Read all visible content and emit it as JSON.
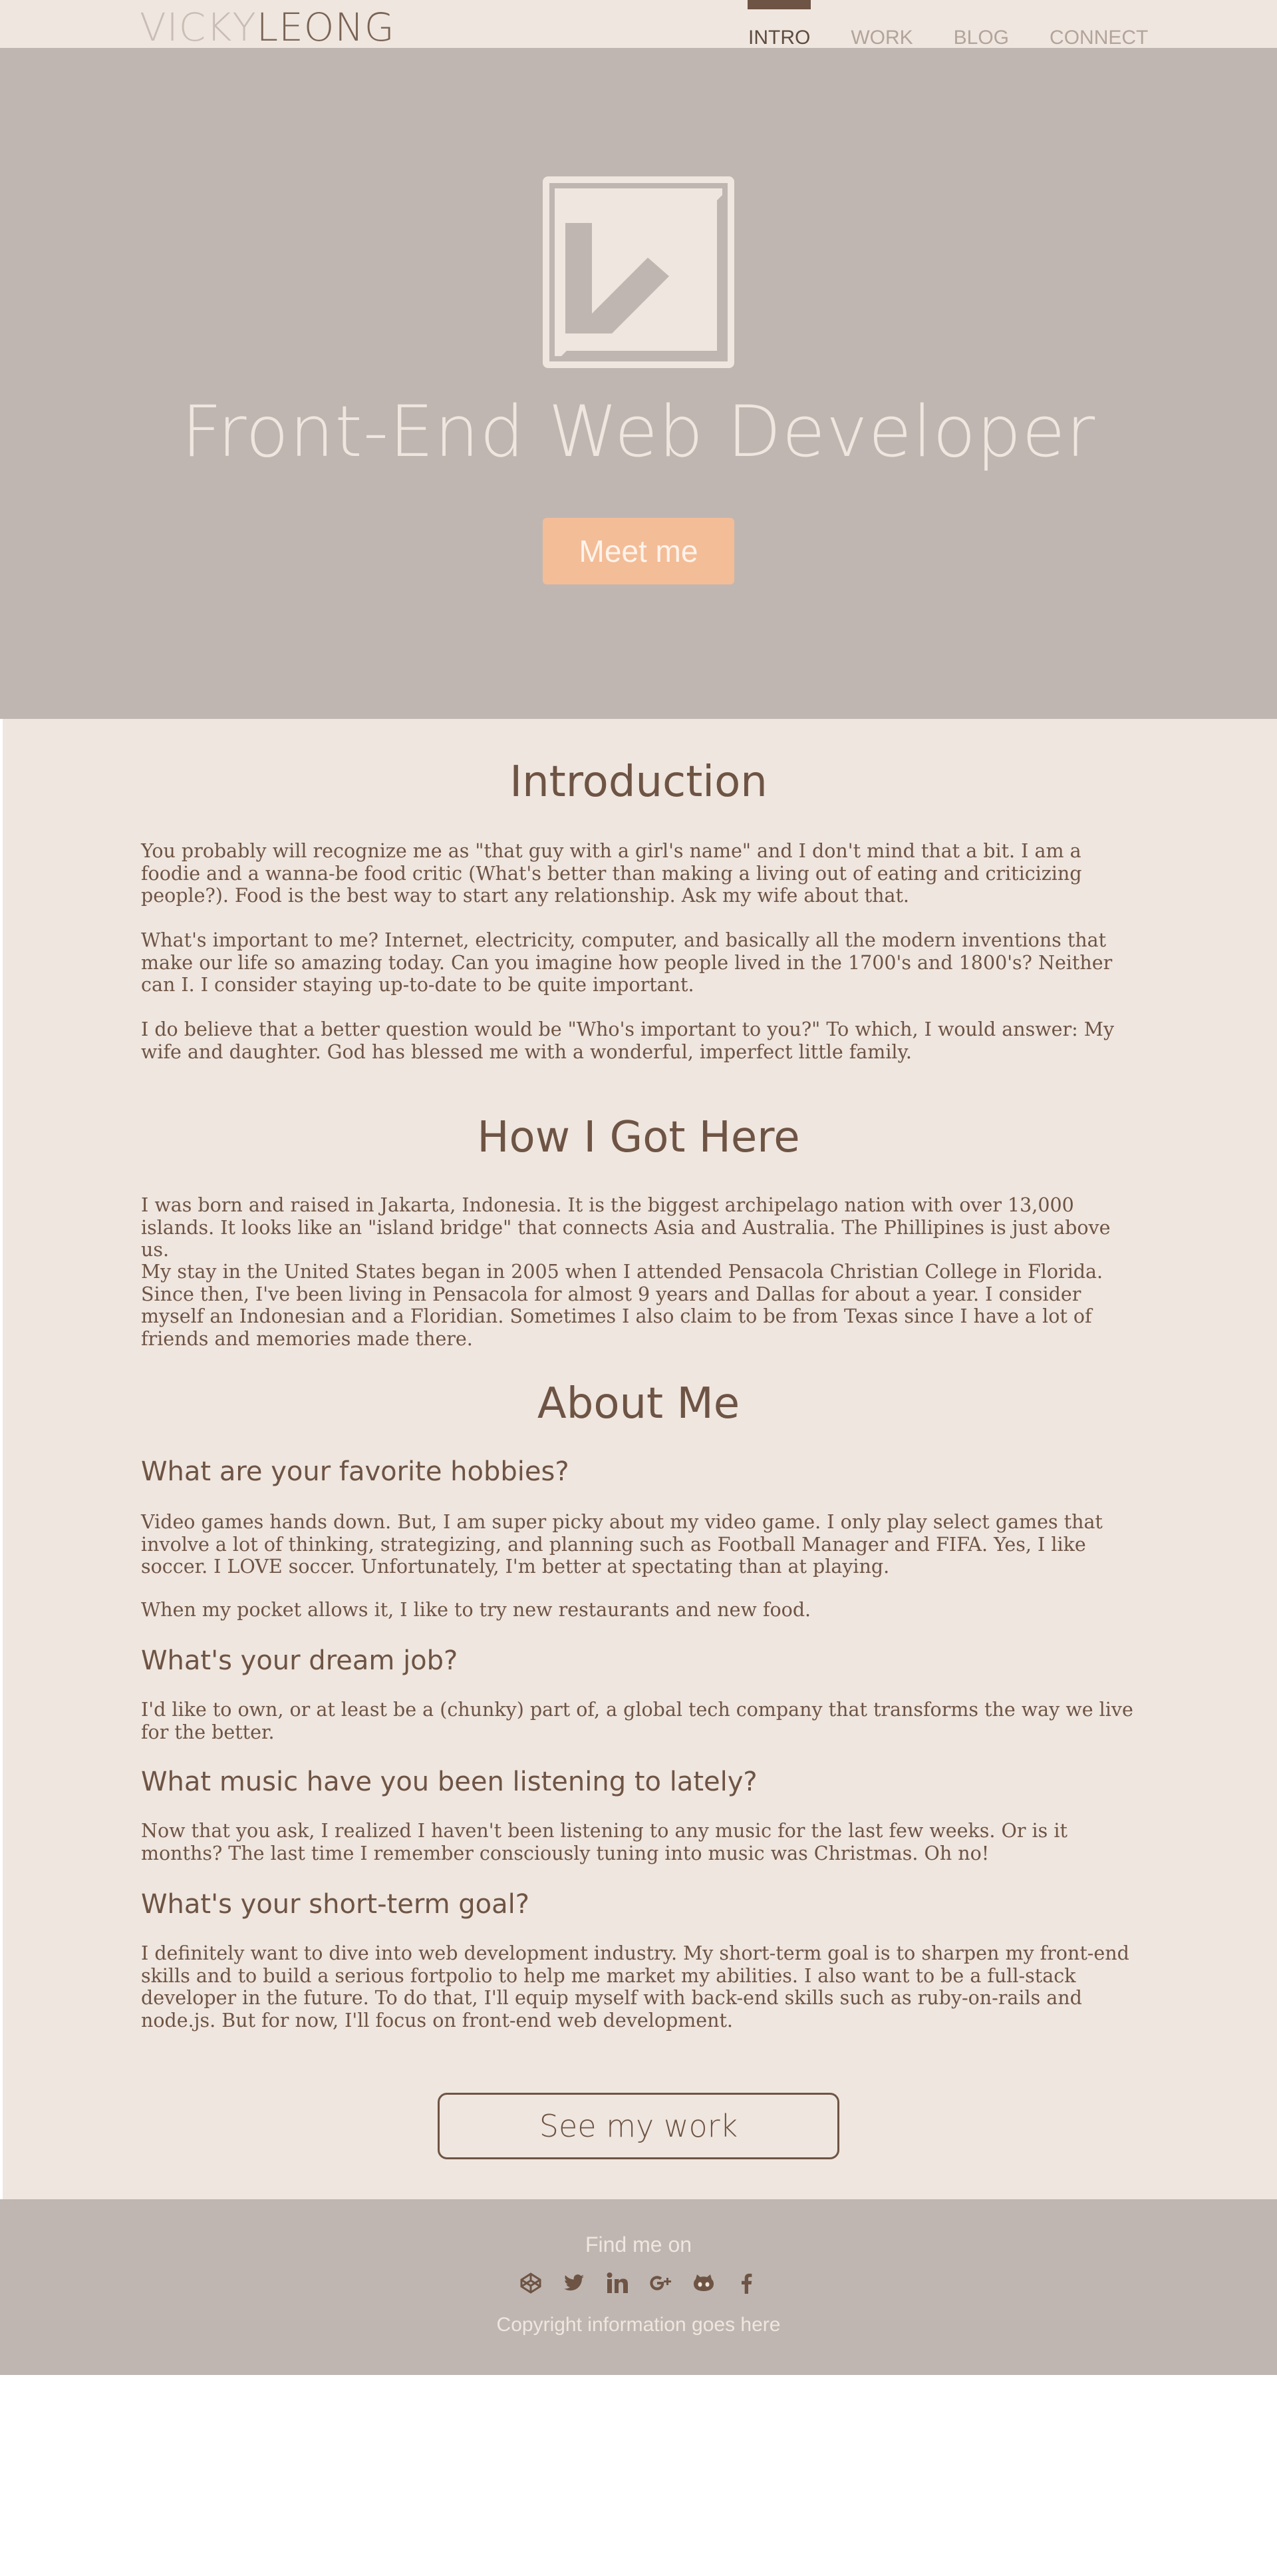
{
  "logo": {
    "first": "VICKY",
    "last": "LEONG"
  },
  "nav": {
    "items": [
      "INTRO",
      "WORK",
      "BLOG",
      "CONNECT"
    ]
  },
  "hero": {
    "title": "Front-End Web Developer",
    "button": "Meet me"
  },
  "intro": {
    "heading": "Introduction",
    "paragraphs": [
      "You probably will recognize me as \"that guy with a girl's name\" and I don't mind that a bit. I am a foodie and a wanna-be food critic (What's better than making a living out of eating and criticizing people?). Food is the best way to start any relationship. Ask my wife about that.",
      "What's important to me? Internet, electricity, computer, and basically all the modern inventions that make our life so amazing today. Can you imagine how people lived in the 1700's and 1800's? Neither can I. I consider staying up-to-date to be quite important.",
      "I do believe that a better question would be \"Who's important to you?\" To which, I would answer: My wife and daughter. God has blessed me with a wonderful, imperfect little family."
    ]
  },
  "how": {
    "heading": "How I Got Here",
    "paragraphs": [
      "I was born and raised in Jakarta, Indonesia. It is the biggest archipelago nation with over 13,000 islands. It looks like an \"island bridge\" that connects Asia and Australia. The Phillipines is just above us.",
      "My stay in the United States began in 2005 when I attended Pensacola Christian College in Florida. Since then, I've been living in Pensacola for almost 9 years and Dallas for about a year. I consider myself an Indonesian and a Floridian. Sometimes I also claim to be from Texas since I have a lot of friends and memories made there."
    ]
  },
  "about": {
    "heading": "About Me",
    "q1": "What are your favorite hobbies?",
    "a1": "Video games hands down. But, I am super picky about my video game. I only play select games that involve a lot of thinking, strategizing, and planning such as Football Manager and FIFA. Yes, I like soccer. I LOVE soccer. Unfortunately, I'm better at spectating than at playing.",
    "a1b": "When my pocket allows it, I like to try new restaurants and new food.",
    "q2": "What's your dream job?",
    "a2": "I'd like to own, or at least be a (chunky) part of, a global tech company that transforms the way we live for the better.",
    "q3": "What music have you been listening to lately?",
    "a3": "Now that you ask, I realized I haven't been listening to any music for the last few weeks. Or is it months? The last time I remember consciously tuning into music was Christmas. Oh no!",
    "q4": "What's your short-term goal?",
    "a4": "I definitely want to dive into web development industry. My short-term goal is to sharpen my front-end skills and to build a serious fortpolio to help me market my abilities. I also want to be a full-stack developer in the future. To do that, I'll equip myself with back-end skills such as ruby-on-rails and node.js. But for now, I'll focus on front-end web development."
  },
  "cta": {
    "button": "See my work"
  },
  "footer": {
    "find": "Find me on",
    "socials": [
      "codepen-icon",
      "twitter-icon",
      "linkedin-icon",
      "google-plus-icon",
      "github-icon",
      "facebook-icon"
    ],
    "copyright": "Copyright information goes here"
  },
  "colors": {
    "brown": "#6e5444",
    "cream": "#efe6df",
    "taupe": "#bfb6b1",
    "peach": "#f3bd98"
  }
}
